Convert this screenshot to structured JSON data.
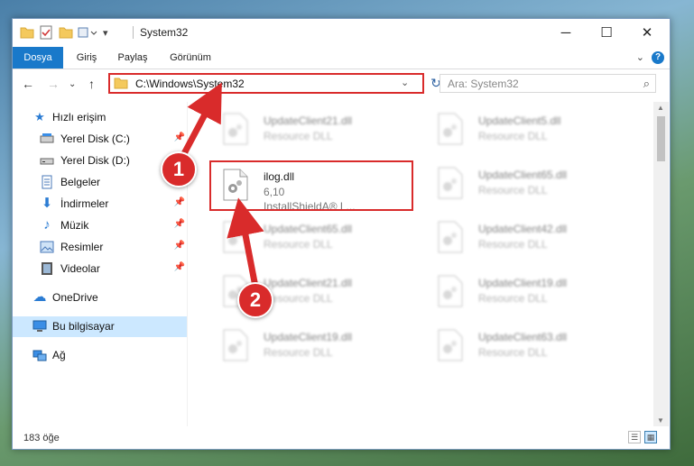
{
  "window": {
    "title": "System32",
    "controls": {
      "minimize": "─",
      "maximize": "☐",
      "close": "✕"
    }
  },
  "ribbon": {
    "tabs": [
      {
        "label": "Dosya",
        "active": true
      },
      {
        "label": "Giriş"
      },
      {
        "label": "Paylaş"
      },
      {
        "label": "Görünüm"
      }
    ],
    "help": "?"
  },
  "address": {
    "path": "C:\\Windows\\System32",
    "search_placeholder": "Ara: System32"
  },
  "sidebar": {
    "items": [
      {
        "label": "Hızlı erişim",
        "icon": "star-icon",
        "glyph": "★",
        "color": "#2b7cd3"
      },
      {
        "label": "Yerel Disk (C:)",
        "icon": "drive-icon",
        "glyph": "▬",
        "color": "#555555",
        "pinned": true
      },
      {
        "label": "Yerel Disk (D:)",
        "icon": "drive-icon",
        "glyph": "▬",
        "color": "#555555",
        "pinned": true
      },
      {
        "label": "Belgeler",
        "icon": "documents-icon",
        "glyph": "▤",
        "color": "#4a78b8",
        "pinned": true
      },
      {
        "label": "İndirmeler",
        "icon": "download-icon",
        "glyph": "⬇",
        "color": "#2b7cd3",
        "pinned": true
      },
      {
        "label": "Müzik",
        "icon": "music-icon",
        "glyph": "♪",
        "color": "#2b7cd3",
        "pinned": true
      },
      {
        "label": "Resimler",
        "icon": "pictures-icon",
        "glyph": "▣",
        "color": "#4a78b8",
        "pinned": true
      },
      {
        "label": "Videolar",
        "icon": "video-icon",
        "glyph": "▦",
        "color": "#444444",
        "pinned": true
      },
      {
        "label": "OneDrive",
        "icon": "cloud-icon",
        "glyph": "☁",
        "color": "#2b7cd3"
      },
      {
        "label": "Bu bilgisayar",
        "icon": "computer-icon",
        "glyph": "▭",
        "color": "#2b7cd3",
        "selected": true
      },
      {
        "label": "Ağ",
        "icon": "network-icon",
        "glyph": "⧉",
        "color": "#2b7cd3"
      }
    ]
  },
  "files": {
    "left": [
      {
        "name": "UpdateClient21.dll",
        "desc": "Resource DLL"
      },
      {
        "name": "ilog.dll",
        "desc": "6,10",
        "desc2": "InstallShieldA® L...",
        "highlighted": true
      },
      {
        "name": "UpdateClient65.dll",
        "desc": "Resource DLL"
      },
      {
        "name": "UpdateClient21.dll",
        "desc": "Resource DLL"
      },
      {
        "name": "UpdateClient19.dll",
        "desc": "Resource DLL"
      }
    ],
    "right": [
      {
        "name": "UpdateClient5.dll",
        "desc": "Resource DLL"
      },
      {
        "name": "UpdateClient65.dll",
        "desc": "Resource DLL"
      },
      {
        "name": "UpdateClient42.dll",
        "desc": "Resource DLL"
      },
      {
        "name": "UpdateClient19.dll",
        "desc": "Resource DLL"
      },
      {
        "name": "UpdateClient63.dll",
        "desc": "Resource DLL"
      }
    ]
  },
  "status": {
    "count": "183 öğe"
  },
  "callouts": {
    "one": "1",
    "two": "2",
    "color": "#d92b2b"
  }
}
